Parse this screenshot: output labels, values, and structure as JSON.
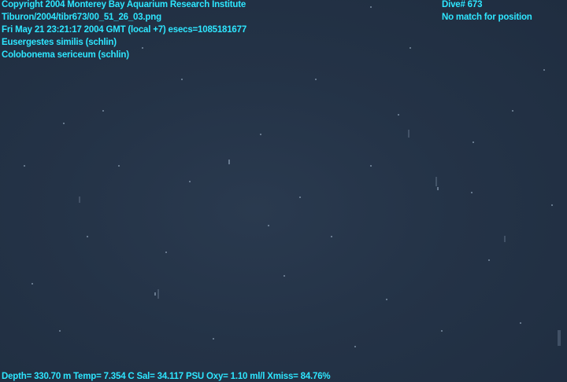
{
  "overlay": {
    "copyright": "Copyright 2004 Monterey Bay Aquarium Research Institute",
    "file_path": "Tiburon/2004/tibr673/00_51_26_03.png",
    "datetime": "Fri May 21 23:21:17 2004 GMT (local +7)  esecs=1085181677",
    "species_1": "Eusergestes similis (schlin)",
    "species_2": "Colobonema sericeum (schlin)",
    "dive": "Dive# 673",
    "position_status": "No match for position",
    "telemetry": "Depth= 330.70 m  Temp= 7.354 C  Sal= 34.117 PSU  Oxy= 1.10 ml/l  Xmiss= 84.76%"
  },
  "colors": {
    "overlay_text": "#2ee6ff",
    "water": "#233246"
  }
}
